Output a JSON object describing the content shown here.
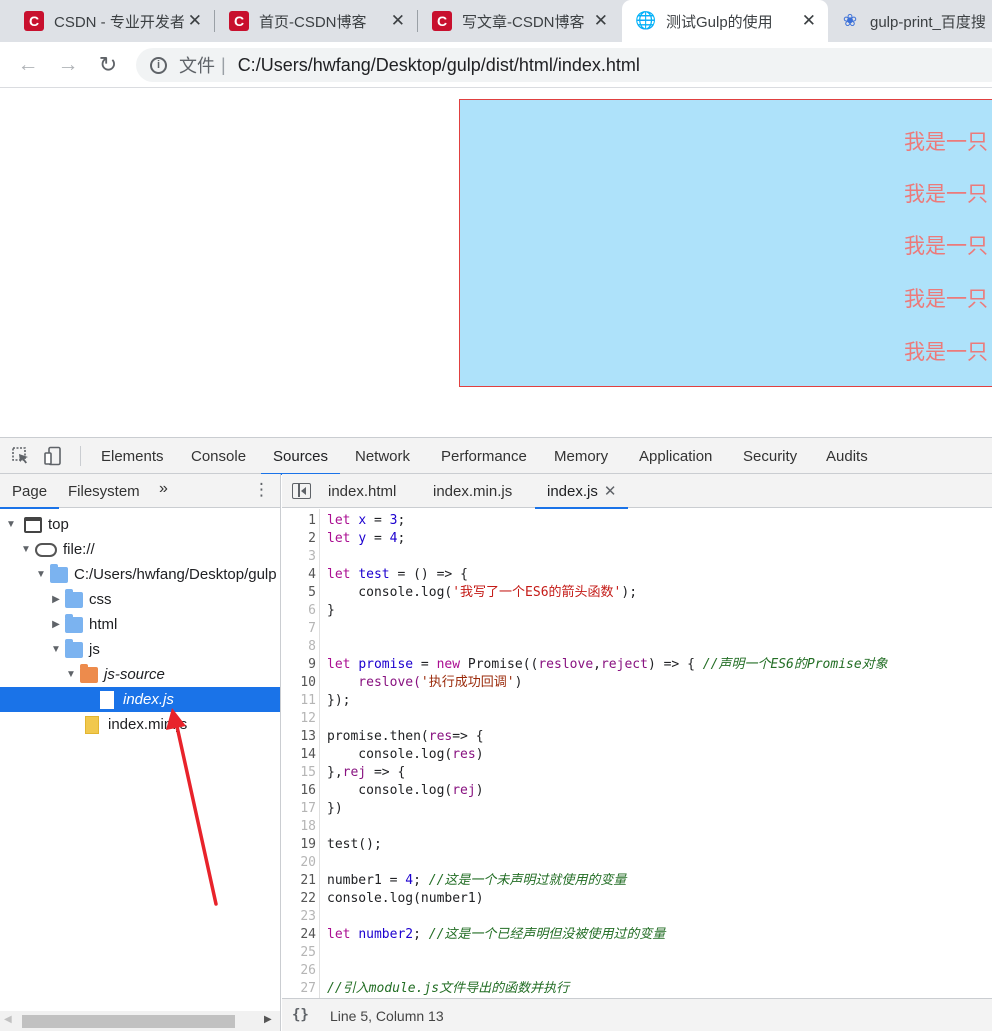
{
  "browser": {
    "tabs": [
      {
        "title": "CSDN - 专业开发者",
        "favicon": "csdn-icon"
      },
      {
        "title": "首页-CSDN博客",
        "favicon": "csdn-icon"
      },
      {
        "title": "写文章-CSDN博客",
        "favicon": "csdn-icon"
      },
      {
        "title": "测试Gulp的使用",
        "favicon": "globe-icon",
        "active": true
      },
      {
        "title": "gulp-print_百度搜",
        "favicon": "baidu-paw-icon"
      }
    ],
    "close_glyph": "✕",
    "address": {
      "scheme_label": "文件",
      "separator": "|",
      "url": "C:/Users/hwfang/Desktop/gulp/dist/html/index.html"
    }
  },
  "page": {
    "box_color": "#aee2fa",
    "text_color": "#ec7a7a",
    "lines": [
      "我是一只",
      "我是一只",
      "我是一只",
      "我是一只",
      "我是一只"
    ]
  },
  "devtools": {
    "panels": [
      "Elements",
      "Console",
      "Sources",
      "Network",
      "Performance",
      "Memory",
      "Application",
      "Security",
      "Audits"
    ],
    "active_panel": "Sources",
    "navigator": {
      "tabs": [
        "Page",
        "Filesystem"
      ],
      "more": "»",
      "tree": [
        {
          "label": "top",
          "icon": "frame-icon"
        },
        {
          "label": "file://",
          "icon": "cloud-icon"
        },
        {
          "label": "C:/Users/hwfang/Desktop/gulp",
          "icon": "folder-icon"
        },
        {
          "label": "css",
          "icon": "folder-icon"
        },
        {
          "label": "html",
          "icon": "folder-icon"
        },
        {
          "label": "js",
          "icon": "folder-icon"
        },
        {
          "label": "js-source",
          "icon": "folder-orange-icon"
        },
        {
          "label": "index.js",
          "icon": "file-icon",
          "selected": true
        },
        {
          "label": "index.min.js",
          "icon": "file-yellow-icon"
        }
      ]
    },
    "editor": {
      "tabs": [
        "index.html",
        "index.min.js",
        "index.js"
      ],
      "active_tab": "index.js",
      "line_numbers": [
        "1",
        "2",
        "3",
        "4",
        "5",
        "6",
        "7",
        "8",
        "9",
        "10",
        "11",
        "12",
        "13",
        "14",
        "15",
        "16",
        "17",
        "18",
        "19",
        "20",
        "21",
        "22",
        "23",
        "24",
        "25",
        "26",
        "27"
      ],
      "tokens": {
        "let": "let",
        "x": "x",
        "y": "y",
        "eq": " = ",
        "n3": "3",
        "n4": "4",
        "semi": ";",
        "test": "test",
        "arrow_fn": " = () => {",
        "console_log_open": "    console.log(",
        "str_es6": "'我写了一个ES6的箭头函数'",
        "close_paren_semi": ");",
        "rbrace": "}",
        "promise": "promise",
        "new": "new",
        "Promise_open": " Promise((",
        "reslove": "reslove",
        "comma": ",",
        "reject": "reject",
        "arrow_brace": ") => { ",
        "cmt_promise": "//声明一个ES6的Promise对象",
        "reslove_indent": "    reslove(",
        "str_success": "'执行成功回调'",
        "close_paren": ")",
        "close_block": "});",
        "promise_then": "promise.then(",
        "res": "res",
        "arrow2": "=> {",
        "console_indent": "    console.log(",
        "rbrace_comma": "},",
        "rej": "rej",
        "arrow3": " => {",
        "close_then": "})",
        "test_call": "test();",
        "number1": "number1",
        "cmt_number1": "//这是一个未声明过就使用的变量",
        "console_number1": "console.log(number1)",
        "number2": "number2",
        "cmt_number2": "//这是一个已经声明但没被使用过的变量",
        "cmt_module": "//引入module.js文件导出的函数并执行"
      }
    },
    "status": {
      "braces": "{}",
      "position": "Line 5, Column 13"
    }
  },
  "annotation_color": "#e8232b"
}
